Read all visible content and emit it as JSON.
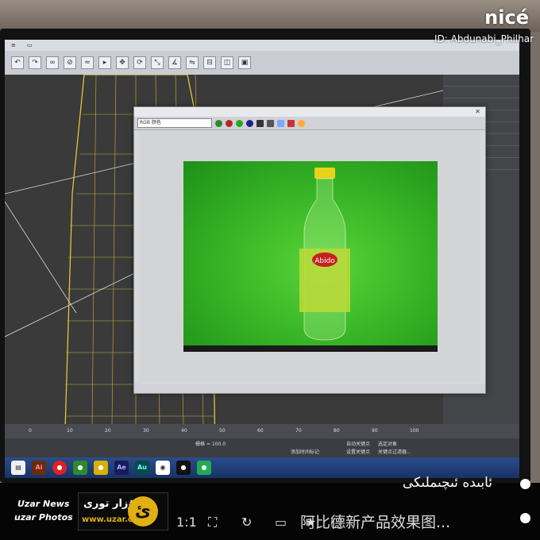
{
  "watermark": {
    "brand": "nicé",
    "id_text": "ID: Abdunabi_Philhar"
  },
  "app": {
    "menu": [
      "",
      "",
      "",
      ""
    ],
    "cmd_panel": {
      "rows": [
        "",
        "",
        "",
        "",
        "",
        "",
        "",
        "",
        "",
        "",
        "",
        ""
      ]
    },
    "timeline_ticks": [
      "0",
      "10",
      "20",
      "30",
      "40",
      "50",
      "60",
      "70",
      "80",
      "90",
      "100"
    ]
  },
  "render_window": {
    "channel_select": "RGB 颜色",
    "product": {
      "label_brand": "Abido"
    }
  },
  "status_bar": {
    "add_time_tag": "添加时间标记",
    "set_key": "设置关键点",
    "key_filter": "关键点过滤器...",
    "auto_key": "自动关键点",
    "selected": "选定对象",
    "scale_label": "栅格 = 100.0"
  },
  "taskbar": {
    "apps": [
      "Ai",
      "Au",
      "Ae"
    ]
  },
  "news": {
    "brand_line1": "Uzar News",
    "brand_line2": "uzar Photos",
    "logo_text": "ئۇزار تورى",
    "logo_url": "www.uzar.cn",
    "caption_ug": "ئابىدە ئىچىملىكى",
    "caption_cn": "阿比德新产品效果图..."
  },
  "viewer_controls": {
    "zoom": "1:1"
  },
  "colors": {
    "render_bg": "#3ab827",
    "accent": "#e0b010",
    "wire": "#e6d23a"
  }
}
